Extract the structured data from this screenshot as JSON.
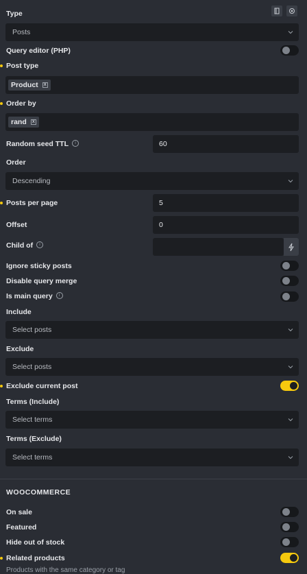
{
  "type": {
    "label": "Type",
    "value": "Posts"
  },
  "query_editor": {
    "label": "Query editor (PHP)"
  },
  "post_type": {
    "label": "Post type",
    "tag": "Product"
  },
  "order_by": {
    "label": "Order by",
    "tag": "rand"
  },
  "random_seed": {
    "label": "Random seed TTL",
    "value": "60"
  },
  "order": {
    "label": "Order",
    "value": "Descending"
  },
  "posts_per_page": {
    "label": "Posts per page",
    "value": "5"
  },
  "offset": {
    "label": "Offset",
    "value": "0"
  },
  "child_of": {
    "label": "Child of",
    "value": ""
  },
  "ignore_sticky": {
    "label": "Ignore sticky posts",
    "on": false
  },
  "disable_merge": {
    "label": "Disable query merge",
    "on": false
  },
  "is_main": {
    "label": "Is main query",
    "on": false
  },
  "include": {
    "label": "Include",
    "placeholder": "Select posts"
  },
  "exclude": {
    "label": "Exclude",
    "placeholder": "Select posts"
  },
  "exclude_current": {
    "label": "Exclude current post",
    "on": true
  },
  "terms_include": {
    "label": "Terms (Include)",
    "placeholder": "Select terms"
  },
  "terms_exclude": {
    "label": "Terms (Exclude)",
    "placeholder": "Select terms"
  },
  "woocommerce": {
    "title": "WOOCOMMERCE",
    "on_sale": {
      "label": "On sale",
      "on": false
    },
    "featured": {
      "label": "Featured",
      "on": false
    },
    "hide_out_of_stock": {
      "label": "Hide out of stock",
      "on": false
    },
    "related_products": {
      "label": "Related products",
      "on": true
    },
    "description": "Products with the same category or tag"
  },
  "info_glyph": "i",
  "tag_remove_glyph": "x",
  "colors": {
    "accent": "#f6c90e",
    "background": "#2a2d34",
    "field": "#1c1e22"
  },
  "icons": [
    "panel-icon",
    "settings-icon",
    "chevron-down-icon",
    "dynamic-data-icon",
    "info-icon",
    "remove-tag-icon"
  ]
}
